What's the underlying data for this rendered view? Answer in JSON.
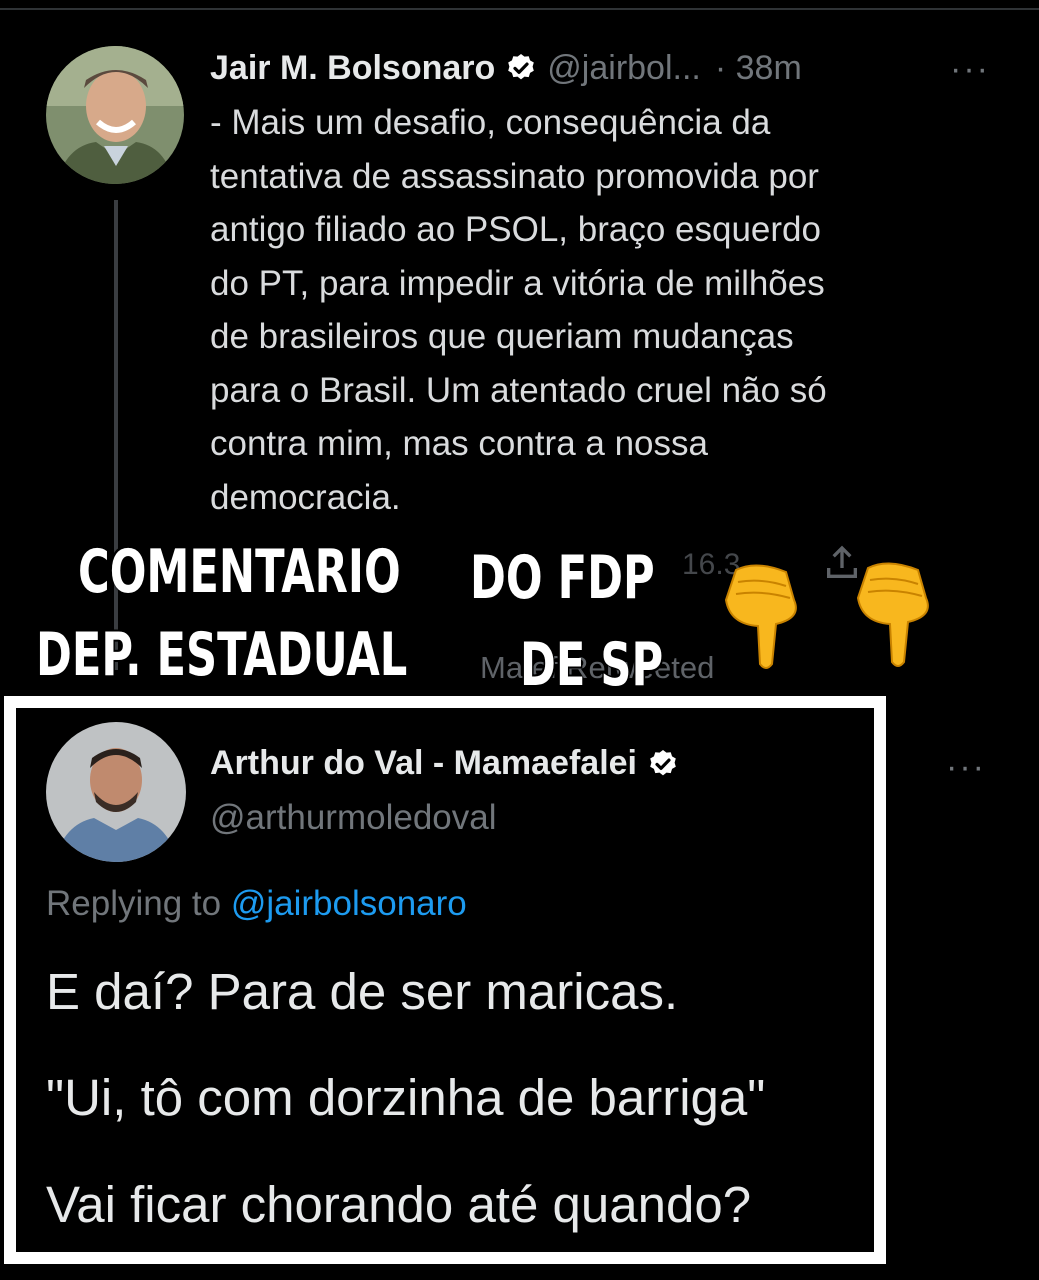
{
  "tweet": {
    "name": "Jair M. Bolsonaro",
    "handle": "@jairbol...",
    "time": "· 38m",
    "more": "···",
    "text": "- Mais um desafio, consequência da\ntentativa de assassinato promovida por\nantigo filiado ao PSOL, braço esquerdo\ndo PT, para impedir a vitória de milhões\nde brasileiros que queriam mudanças\npara o Brasil. Um atentado cruel não só\ncontra mim, mas contra a nossa\ndemocracia.",
    "actions_partial": "16.3",
    "retweet_partial": "Ma        ef     Retweeted"
  },
  "overlay": {
    "line1a": "COMENTARIO",
    "line1b": "DO FDP",
    "line2a": "DEP. ESTADUAL",
    "line2b": "DE SP",
    "emoji": "👇"
  },
  "reply_tweet": {
    "name": "Arthur do Val - Mamaefalei",
    "handle": "@arthurmoledoval",
    "more": "···",
    "replying_prefix": "Replying to ",
    "replying_to": "@jairbolsonaro",
    "line1": "E daí? Para de ser maricas.",
    "line2": "\"Ui, tô com dorzinha de barriga\"",
    "line3": "Vai ficar chorando até quando?"
  },
  "colors": {
    "background": "#000000",
    "verified_badge": "#ffffff",
    "link_blue": "#1d9bf0",
    "muted": "#71767b",
    "frame": "#ffffff"
  }
}
